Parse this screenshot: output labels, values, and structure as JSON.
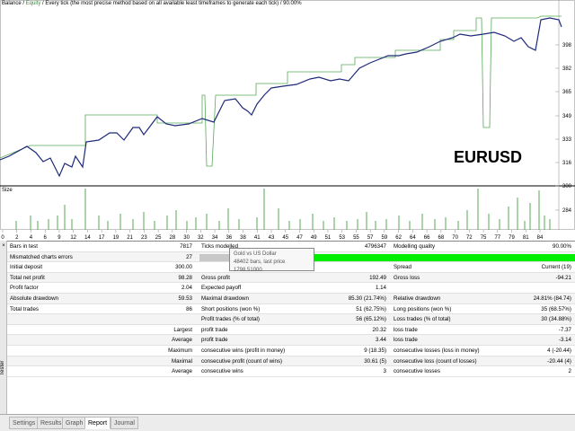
{
  "chart": {
    "legend_balance": "Balance",
    "legend_sep": " / ",
    "legend_equity": "Equity",
    "legend_rest": " / Every tick (the most precise method based on all available least timeframes to generate each tick) / 90.00%",
    "symbol_overlay": "EURUSD",
    "size_label": "Size",
    "y_ticks": [
      "398",
      "382",
      "365",
      "349",
      "333",
      "316",
      "300",
      "284"
    ],
    "x_ticks": [
      "0",
      "2",
      "4",
      "6",
      "9",
      "12",
      "14",
      "17",
      "19",
      "21",
      "23",
      "25",
      "28",
      "30",
      "32",
      "34",
      "36",
      "38",
      "41",
      "43",
      "45",
      "47",
      "49",
      "51",
      "53",
      "55",
      "57",
      "59",
      "62",
      "64",
      "66",
      "68",
      "70",
      "72",
      "75",
      "77",
      "79",
      "81",
      "84"
    ],
    "colors": {
      "balance": "#1f2a7a",
      "equity": "#5aa85a",
      "volume": "#5aa85a"
    }
  },
  "tooltip": {
    "line1": "Gold vs US Dollar",
    "line2": "48402 bars, last price 1798.51000"
  },
  "report": {
    "bars_label": "Bars in test",
    "bars_value": "7817",
    "ticks_label": "Ticks modelled",
    "ticks_value": "4796347",
    "quality_label": "Modelling quality",
    "quality_value": "90.00%",
    "mismatch_label": "Mismatched charts errors",
    "mismatch_value": "27",
    "quality_fraction": 0.9,
    "deposit_label": "Initial deposit",
    "deposit_value": "300.00",
    "spread_label": "Spread",
    "spread_value": "Current (19)",
    "net_label": "Total net profit",
    "net_value": "98.28",
    "gross_profit_label": "Gross profit",
    "gross_profit_value": "192.49",
    "gross_loss_label": "Gross loss",
    "gross_loss_value": "-94.21",
    "pf_label": "Profit factor",
    "pf_value": "2.04",
    "ep_label": "Expected payoff",
    "ep_value": "1.14",
    "abs_dd_label": "Absolute drawdown",
    "abs_dd_value": "59.53",
    "max_dd_label": "Maximal drawdown",
    "max_dd_value": "85.30 (21.74%)",
    "rel_dd_label": "Relative drawdown",
    "rel_dd_value": "24.81% (84.74)",
    "trades_label": "Total trades",
    "trades_value": "86",
    "short_label": "Short positions (won %)",
    "short_value": "51 (62.75%)",
    "long_label": "Long positions (won %)",
    "long_value": "35 (68.57%)",
    "pt_label": "Profit trades (% of total)",
    "pt_value": "56 (65.12%)",
    "lt_label": "Loss trades (% of total)",
    "lt_value": "30 (34.88%)",
    "largest_label": "Largest",
    "largest_profit_label": "profit trade",
    "largest_profit_value": "20.32",
    "largest_loss_label": "loss trade",
    "largest_loss_value": "-7.37",
    "average_label": "Average",
    "average_profit_label": "profit trade",
    "average_profit_value": "3.44",
    "average_loss_label": "loss trade",
    "average_loss_value": "-3.14",
    "maximum_label": "Maximum",
    "max_wins_label": "consecutive wins (profit in money)",
    "max_wins_value": "9 (18.35)",
    "max_losses_label": "consecutive losses (loss in money)",
    "max_losses_value": "4 (-20.44)",
    "maximal_label": "Maximal",
    "maxl_profit_label": "consecutive profit (count of wins)",
    "maxl_profit_value": "30.61 (5)",
    "maxl_loss_label": "consecutive loss (count of losses)",
    "maxl_loss_value": "-20.44 (4)",
    "avg2_label": "Average",
    "avg_wins_label": "consecutive wins",
    "avg_wins_value": "3",
    "avg_losses_label": "consecutive losses",
    "avg_losses_value": "2"
  },
  "sidebar": {
    "label": "Tester",
    "close": "×"
  },
  "tabs": [
    "Settings",
    "Results",
    "Graph",
    "Report",
    "Journal"
  ]
}
